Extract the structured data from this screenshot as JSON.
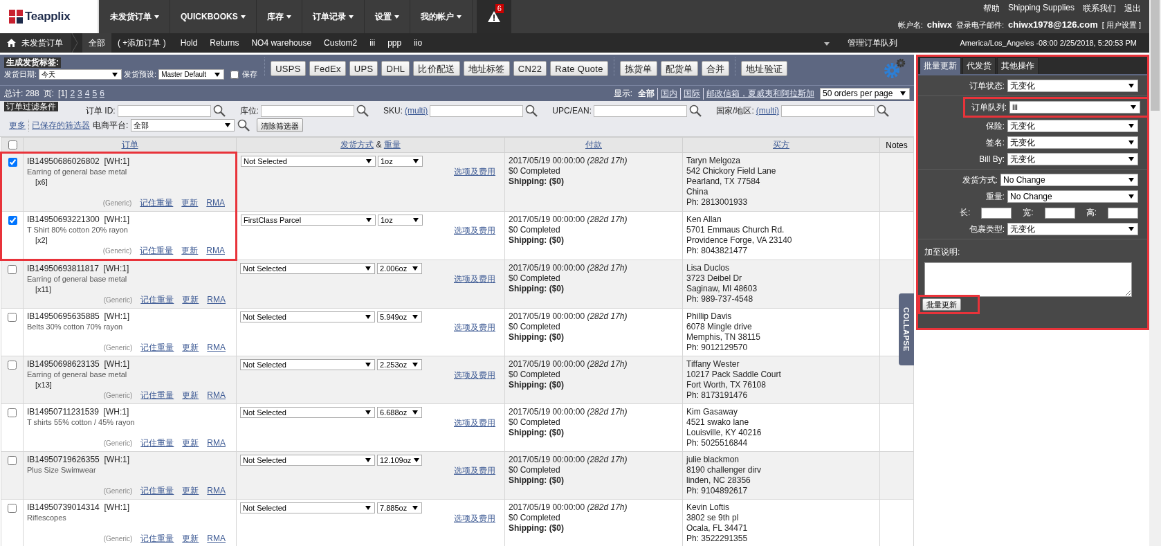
{
  "logo": {
    "text": "Teapplix"
  },
  "nav": [
    {
      "label": "未发货订单"
    },
    {
      "label": "QUICKBOOKS"
    },
    {
      "label": "库存"
    },
    {
      "label": "订单记录"
    },
    {
      "label": "设置"
    },
    {
      "label": "我的帐户"
    }
  ],
  "alert": {
    "count": "6"
  },
  "top_links": [
    "帮助",
    "Shipping Supplies",
    "联系我们",
    "退出"
  ],
  "account": {
    "name_label": "帐户名:",
    "name": "chiwx",
    "email_label": "登录电子邮件:",
    "email": "chiwx1978@126.com",
    "settings": "[ 用户设置 ]"
  },
  "subnav": {
    "home": "未发货订单",
    "add_order": "( +添加订单 )",
    "tabs": [
      {
        "label": "全部",
        "selected": true
      },
      {
        "label": "Hold",
        "selected": false
      },
      {
        "label": "Returns",
        "selected": false
      },
      {
        "label": "NO4 warehouse",
        "selected": false
      },
      {
        "label": "Custom2",
        "selected": false
      },
      {
        "label": "iii",
        "selected": false
      },
      {
        "label": "ppp",
        "selected": false
      },
      {
        "label": "iio",
        "selected": false
      }
    ],
    "manage": "管理订单队列",
    "timezone": "America/Los_Angeles -08:00 2/25/2018, 5:20:53 PM"
  },
  "toolbar": {
    "title": "生成发货标签:",
    "date_label": "发货日期:",
    "date": "今天",
    "preset_label": "发货预设:",
    "preset": "Master Default",
    "save": {
      "label": "保存",
      "checked": false
    },
    "button_groups": [
      [
        "USPS",
        "FedEx",
        "UPS",
        "DHL",
        "比价配送",
        "地址标签",
        "CN22",
        "Rate Quote"
      ],
      [
        "拣货单",
        "配货单",
        "合并"
      ],
      [
        "地址验证"
      ]
    ]
  },
  "pagination": {
    "total": "总计: 288",
    "pages_label": "页:",
    "pages": [
      {
        "label": "[1]",
        "selected": true
      },
      {
        "label": "2",
        "selected": false
      },
      {
        "label": "3",
        "selected": false
      },
      {
        "label": "4",
        "selected": false
      },
      {
        "label": "5",
        "selected": false
      },
      {
        "label": "6",
        "selected": false
      }
    ],
    "show_label": "显示:",
    "show_options": [
      {
        "label": "全部",
        "selected": true
      },
      {
        "label": "国内",
        "selected": false
      },
      {
        "label": "国际",
        "selected": false
      },
      {
        "label": "邮政信箱，夏威夷和阿拉斯加",
        "selected": false
      }
    ],
    "per_page": "50 orders per page"
  },
  "filters": {
    "title": "订单过滤条件",
    "fields": [
      {
        "label": "订单 ID:"
      },
      {
        "label": "库位:"
      },
      {
        "label": "SKU:",
        "multi": "(multi)"
      },
      {
        "label": "UPC/EAN:"
      },
      {
        "label": "国家/地区:",
        "multi": "(multi)"
      }
    ],
    "more": "更多",
    "saved": "已保存的筛选器",
    "platform_label": "电商平台:",
    "platform": "全部",
    "clear": "清除筛选器"
  },
  "table": {
    "select_all": {
      "checked": false
    },
    "columns": {
      "order": "订单",
      "shipping": "发货方式",
      "joiner": "&",
      "weight": "重量",
      "payment": "付款",
      "buyer": "买方",
      "notes": "Notes"
    },
    "rows": [
      {
        "checked": true,
        "highlighted": true,
        "id": "IB14950686026802",
        "wh": "[WH:1]",
        "description": "Earring of general base metal",
        "qty": "[x6]",
        "generic": "(Generic)",
        "links": [
          "记住重量",
          "更新",
          "RMA"
        ],
        "method": "Not Selected",
        "weight": "1oz",
        "options": "选项及费用",
        "date": "2017/05/19 00:00:00",
        "age": "(282d 17h)",
        "status": "$0 Completed",
        "shipping": "Shipping: ($0)",
        "buyer": [
          "Taryn Melgoza",
          "542 Chickory Field Lane",
          "Pearland, TX 77584",
          "China",
          "Ph: 2813001933"
        ]
      },
      {
        "checked": true,
        "highlighted": true,
        "id": "IB14950693221300",
        "wh": "[WH:1]",
        "description": "T Shirt 80% cotton 20% rayon",
        "qty": "[x2]",
        "generic": "(Generic)",
        "links": [
          "记住重量",
          "更新",
          "RMA"
        ],
        "method": "FirstClass Parcel",
        "weight": "1oz",
        "options": "选项及费用",
        "date": "2017/05/19 00:00:00",
        "age": "(282d 17h)",
        "status": "$0 Completed",
        "shipping": "Shipping: ($0)",
        "buyer": [
          "Ken Allan",
          "5701 Emmaus Church Rd.",
          "Providence Forge, VA 23140",
          "Ph: 8043821477"
        ]
      },
      {
        "checked": false,
        "highlighted": false,
        "id": "IB14950693811817",
        "wh": "[WH:1]",
        "description": "Earring of general base metal",
        "qty": "[x11]",
        "generic": "(Generic)",
        "links": [
          "记住重量",
          "更新",
          "RMA"
        ],
        "method": "Not Selected",
        "weight": "2.006oz",
        "options": "选项及费用",
        "date": "2017/05/19 00:00:00",
        "age": "(282d 17h)",
        "status": "$0 Completed",
        "shipping": "Shipping: ($0)",
        "buyer": [
          "Lisa Duclos",
          "3723 Deibel Dr",
          "Saginaw, MI 48603",
          "Ph: 989-737-4548"
        ]
      },
      {
        "checked": false,
        "highlighted": false,
        "id": "IB14950695635885",
        "wh": "[WH:1]",
        "description": "Belts 30% cotton 70% rayon",
        "generic": "(Generic)",
        "links": [
          "记住重量",
          "更新",
          "RMA"
        ],
        "method": "Not Selected",
        "weight": "5.949oz",
        "options": "选项及费用",
        "date": "2017/05/19 00:00:00",
        "age": "(282d 17h)",
        "status": "$0 Completed",
        "shipping": "Shipping: ($0)",
        "buyer": [
          "Phillip Davis",
          "6078 Mingle drive",
          "Memphis, TN 38115",
          "Ph: 9012129570"
        ]
      },
      {
        "checked": false,
        "highlighted": false,
        "id": "IB14950698623135",
        "wh": "[WH:1]",
        "description": "Earring of general base metal",
        "qty": "[x13]",
        "generic": "(Generic)",
        "links": [
          "记住重量",
          "更新",
          "RMA"
        ],
        "method": "Not Selected",
        "weight": "2.253oz",
        "options": "选项及费用",
        "date": "2017/05/19 00:00:00",
        "age": "(282d 17h)",
        "status": "$0 Completed",
        "shipping": "Shipping: ($0)",
        "buyer": [
          "Tiffany Wester",
          "10217 Pack Saddle Court",
          "Fort Worth, TX 76108",
          "Ph: 8173191476"
        ]
      },
      {
        "checked": false,
        "highlighted": false,
        "id": "IB14950711231539",
        "wh": "[WH:1]",
        "description": "T shirts 55% cotton / 45% rayon",
        "generic": "(Generic)",
        "links": [
          "记住重量",
          "更新",
          "RMA"
        ],
        "method": "Not Selected",
        "weight": "6.688oz",
        "options": "选项及费用",
        "date": "2017/05/19 00:00:00",
        "age": "(282d 17h)",
        "status": "$0 Completed",
        "shipping": "Shipping: ($0)",
        "buyer": [
          "Kim Gasaway",
          "4521 swako lane",
          "Louisville, KY 40216",
          "Ph: 5025516844"
        ]
      },
      {
        "checked": false,
        "highlighted": false,
        "id": "IB14950719626355",
        "wh": "[WH:1]",
        "description": "Plus Size Swimwear",
        "generic": "(Generic)",
        "links": [
          "记住重量",
          "更新",
          "RMA"
        ],
        "method": "Not Selected",
        "weight": "12.109oz",
        "options": "选项及费用",
        "date": "2017/05/19 00:00:00",
        "age": "(282d 17h)",
        "status": "$0 Completed",
        "shipping": "Shipping: ($0)",
        "buyer": [
          "julie blackmon",
          "8190 challenger dirv",
          "linden, NC 28356",
          "Ph: 9104892617"
        ]
      },
      {
        "checked": false,
        "highlighted": false,
        "id": "IB14950739014314",
        "wh": "[WH:1]",
        "description": "Riflescopes",
        "generic": "(Generic)",
        "links": [
          "记住重量",
          "更新",
          "RMA"
        ],
        "method": "Not Selected",
        "weight": "7.885oz",
        "options": "选项及费用",
        "date": "2017/05/19 00:00:00",
        "age": "(282d 17h)",
        "status": "$0 Completed",
        "shipping": "Shipping: ($0)",
        "buyer": [
          "Kevin Loftis",
          "3802 se 9th pl",
          "Ocala, FL 34471",
          "Ph: 3522291355"
        ]
      }
    ]
  },
  "collapse": "COLLAPSE",
  "panel": {
    "highlighted": true,
    "tabs": [
      {
        "label": "批量更新",
        "selected": true
      },
      {
        "label": "代发货",
        "selected": false
      },
      {
        "label": "其他操作",
        "selected": false
      }
    ],
    "sections": [
      [
        {
          "kind": "select",
          "label": "订单状态:",
          "value": "无变化",
          "highlighted": false
        }
      ],
      [
        {
          "kind": "select",
          "label": "订单队列:",
          "value": "iii",
          "highlighted": true
        },
        {
          "kind": "select",
          "label": "保险:",
          "value": "无变化",
          "highlighted": false
        },
        {
          "kind": "select",
          "label": "签名:",
          "value": "无变化",
          "highlighted": false
        },
        {
          "kind": "select",
          "label": "Bill By:",
          "value": "无变化",
          "highlighted": false
        }
      ],
      [
        {
          "kind": "select",
          "label": "发货方式:",
          "value": "No Change",
          "highlighted": false
        },
        {
          "kind": "select",
          "label": "重量:",
          "value": "No Change",
          "highlighted": false
        },
        {
          "kind": "dims",
          "labels": [
            "长:",
            "宽:",
            "高:"
          ]
        },
        {
          "kind": "select",
          "label": "包裹类型:",
          "value": "无变化",
          "highlighted": false
        }
      ]
    ],
    "note_label": "加至说明:",
    "button": {
      "label": "批量更新",
      "highlighted": true
    }
  }
}
